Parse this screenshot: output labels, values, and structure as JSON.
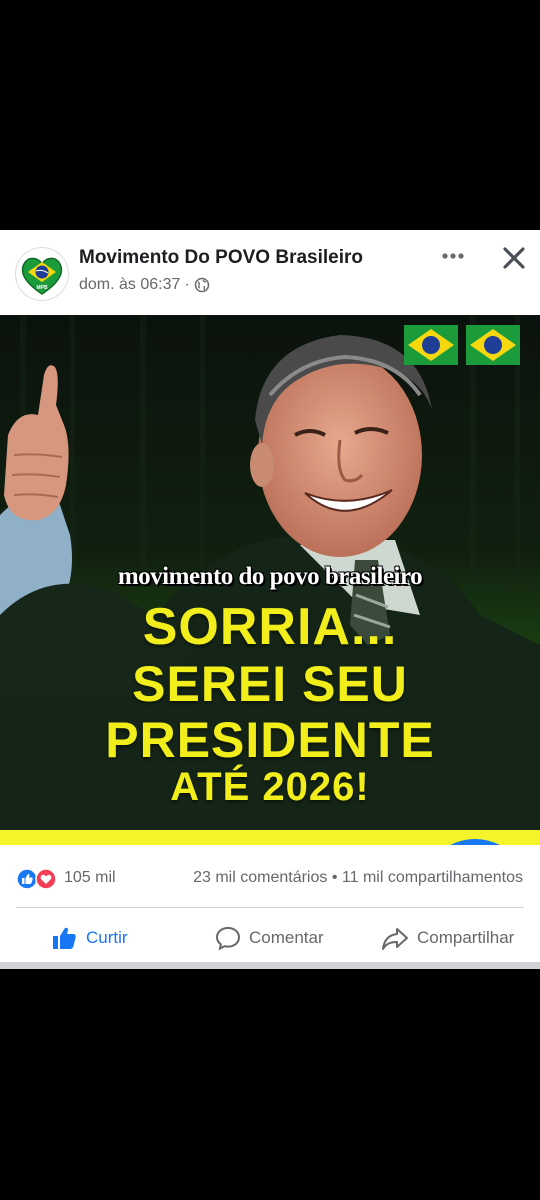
{
  "post": {
    "page_name": "Movimento Do POVO Brasileiro",
    "timestamp": "dom. às 06:37",
    "separator": "·",
    "avatar_icon": "brazil-heart-flag-icon",
    "more_icon": "more-horizontal-icon",
    "close_icon": "close-icon",
    "privacy_icon": "globe-icon"
  },
  "image": {
    "watermark": "movimento do povo brasileiro",
    "headline_1": "SORRIA...",
    "headline_2": "SEREI SEU",
    "headline_3": "PRESIDENTE",
    "headline_4": "ATÉ 2026!",
    "flag_icon": "brazil-flag-icon",
    "headline_color": "#f2ee1c"
  },
  "stats": {
    "reactions_count": "105 mil",
    "comments": "23 mil comentários",
    "dot": "•",
    "shares": "11 mil compartilhamentos",
    "reaction_icons": [
      "like-icon",
      "love-icon"
    ]
  },
  "actions": {
    "like_label": "Curtir",
    "comment_label": "Comentar",
    "share_label": "Compartilhar",
    "like_icon": "thumbs-up-icon",
    "comment_icon": "comment-icon",
    "share_icon": "share-icon"
  },
  "colors": {
    "brand_blue": "#1877f2",
    "muted_text": "#65676b",
    "flag_green": "#1c9b3a",
    "flag_yellow": "#f6d80f"
  }
}
